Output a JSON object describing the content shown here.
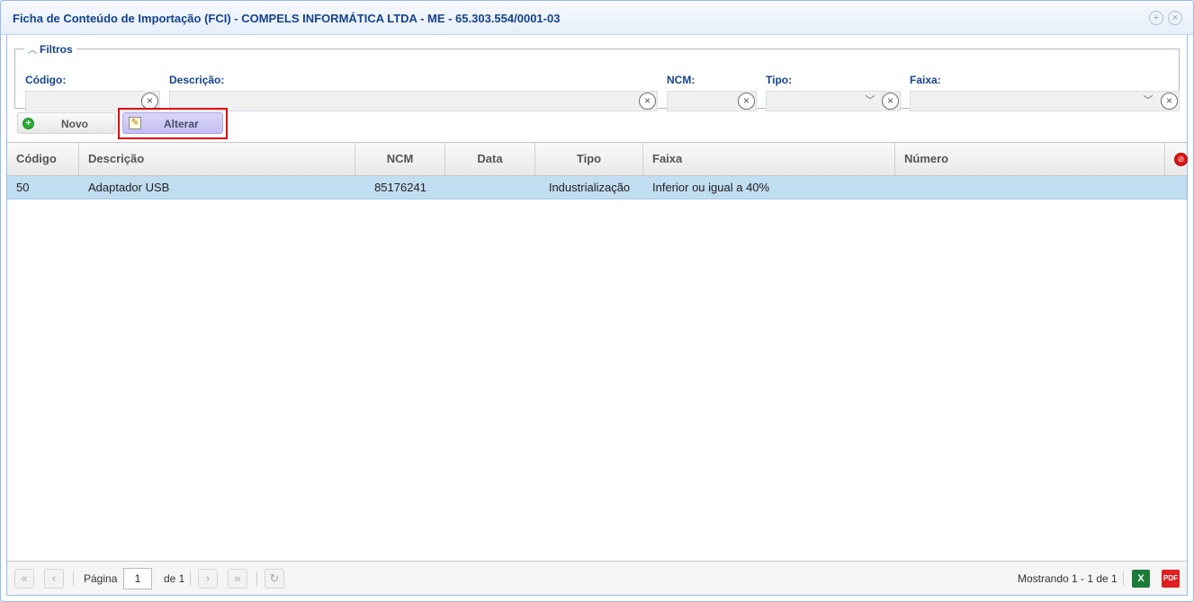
{
  "window": {
    "title": "Ficha de Conteúdo de Importação (FCI) - COMPELS INFORMÁTICA LTDA - ME - 65.303.554/0001-03",
    "tools": [
      "restore-icon",
      "close-icon"
    ]
  },
  "filters": {
    "legend": "Filtros",
    "codigo": {
      "label": "Código:",
      "value": ""
    },
    "descricao": {
      "label": "Descrição:",
      "value": ""
    },
    "ncm": {
      "label": "NCM:",
      "value": ""
    },
    "tipo": {
      "label": "Tipo:",
      "value": ""
    },
    "faixa": {
      "label": "Faixa:",
      "value": ""
    }
  },
  "toolbar": {
    "novo_label": "Novo",
    "alterar_label": "Alterar"
  },
  "grid": {
    "columns": [
      "Código",
      "Descrição",
      "NCM",
      "Data",
      "Tipo",
      "Faixa",
      "Número"
    ],
    "rows": [
      {
        "codigo": "50",
        "descricao": "Adaptador USB",
        "ncm": "85176241",
        "data": "",
        "tipo": "Industrialização",
        "faixa": "Inferior ou igual a 40%",
        "numero": ""
      }
    ],
    "selected_row": 0
  },
  "pager": {
    "page_label": "Página",
    "current_page": "1",
    "of_label": "de 1",
    "display_info": "Mostrando 1 - 1 de 1"
  },
  "export": {
    "excel_label": "X",
    "pdf_label": "PDF"
  },
  "colors": {
    "title": "#15428b",
    "selected_row": "#c1ddf1",
    "highlight": "#e0000f",
    "excel": "#1d7a3a",
    "pdf": "#e02020"
  }
}
